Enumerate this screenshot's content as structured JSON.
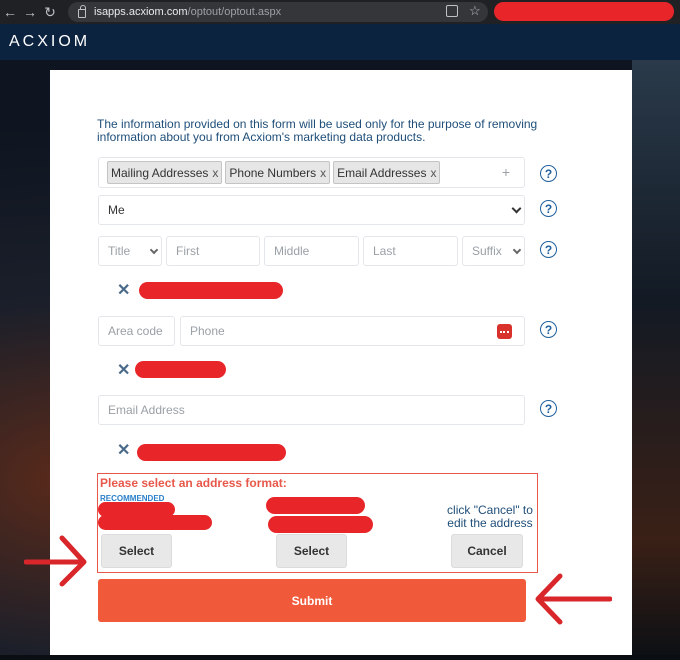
{
  "browser": {
    "url_host": "isapps.acxiom.com",
    "url_path": "/optout/optout.aspx"
  },
  "site": {
    "logo": "ACXIOM"
  },
  "form": {
    "intro": "The information provided on this form will be used only for the purpose of removing information about you from Acxiom's marketing data products.",
    "tags": [
      {
        "label": "Mailing Addresses",
        "remove": "x"
      },
      {
        "label": "Phone Numbers",
        "remove": "x"
      },
      {
        "label": "Email Addresses",
        "remove": "x"
      }
    ],
    "add_symbol": "+",
    "requester_select": "Me",
    "name_fields": {
      "title_placeholder": "Title",
      "first_placeholder": "First",
      "middle_placeholder": "Middle",
      "last_placeholder": "Last",
      "suffix_placeholder": "Suffix"
    },
    "phone_fields": {
      "area_code_placeholder": "Area code",
      "phone_placeholder": "Phone"
    },
    "email_placeholder": "Email Address",
    "help_symbol": "?",
    "remove_symbol": "✕",
    "address_format": {
      "title": "Please select an address format:",
      "recommended_label": "RECOMMENDED",
      "cancel_note": "click \"Cancel\" to edit the address",
      "select_label": "Select",
      "cancel_label": "Cancel"
    },
    "submit_label": "Submit"
  },
  "colors": {
    "submit": "#f05a3a",
    "address_border": "#e8584a",
    "redaction": "#e8262a",
    "help": "#1f5f9c",
    "header": "#0c2340"
  }
}
